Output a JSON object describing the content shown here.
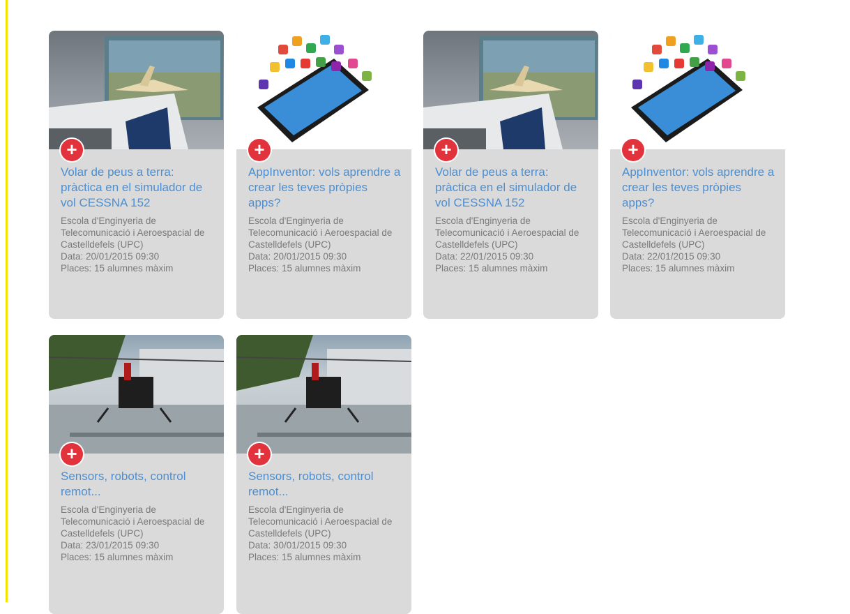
{
  "cards": [
    {
      "title": "Volar de peus a terra: pràctica en el simulador de vol CESSNA 152",
      "school": "Escola d'Enginyeria de Telecomunicació i Aeroespacial de Castelldefels (UPC)",
      "date": "Data: 20/01/2015 09:30",
      "places": "Places: 15 alumnes màxim",
      "image": "flight-simulator-photo"
    },
    {
      "title": "AppInventor: vols aprendre a crear les teves pròpies apps?",
      "school": "Escola d'Enginyeria de Telecomunicació i Aeroespacial de Castelldefels (UPC)",
      "date": "Data: 20/01/2015 09:30",
      "places": "Places: 15 alumnes màxim",
      "image": "smartphone-apps-illustration"
    },
    {
      "title": "Volar de peus a terra: pràctica en el simulador de vol CESSNA 152",
      "school": "Escola d'Enginyeria de Telecomunicació i Aeroespacial de Castelldefels (UPC)",
      "date": "Data: 22/01/2015 09:30",
      "places": "Places: 15 alumnes màxim",
      "image": "flight-simulator-photo"
    },
    {
      "title": "AppInventor: vols aprendre a crear les teves pròpies apps?",
      "school": "Escola d'Enginyeria de Telecomunicació i Aeroespacial de Castelldefels (UPC)",
      "date": "Data: 22/01/2015 09:30",
      "places": "Places: 15 alumnes màxim",
      "image": "smartphone-apps-illustration"
    },
    {
      "title": "Sensors, robots, control remot...",
      "school": "Escola d'Enginyeria de Telecomunicació i Aeroespacial de Castelldefels (UPC)",
      "date": "Data: 23/01/2015 09:30",
      "places": "Places: 15 alumnes màxim",
      "image": "drone-helicopter-photo"
    },
    {
      "title": "Sensors, robots, control remot...",
      "school": "Escola d'Enginyeria de Telecomunicació i Aeroespacial de Castelldefels (UPC)",
      "date": "Data: 30/01/2015 09:30",
      "places": "Places: 15 alumnes màxim",
      "image": "drone-helicopter-photo"
    }
  ],
  "colors": {
    "accent_red": "#e2323b",
    "title_blue": "#4a8fd4",
    "card_bg": "#dadada",
    "side_rule": "#f2e600"
  },
  "icons": {
    "add": "plus-icon"
  }
}
